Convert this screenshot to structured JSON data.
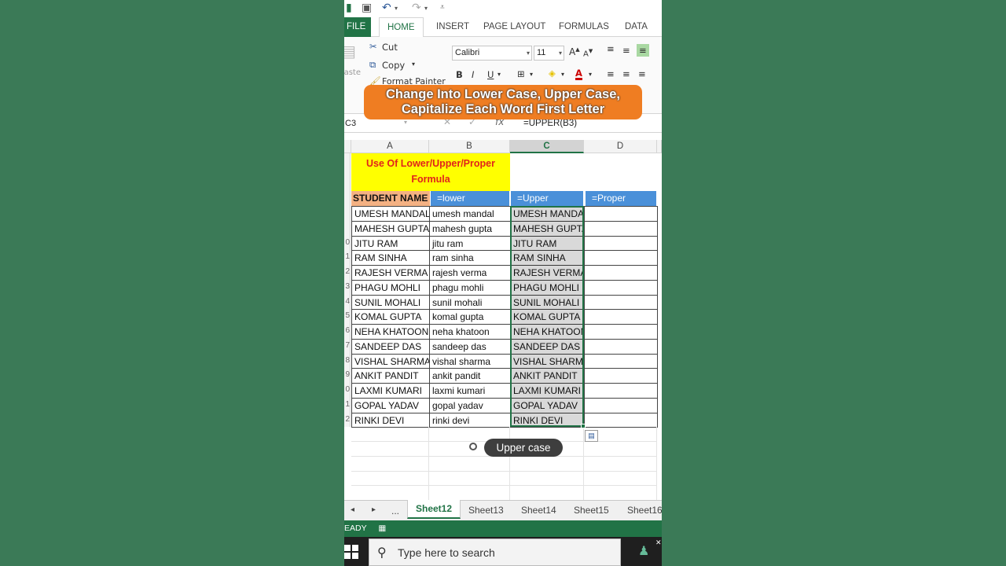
{
  "qat": {
    "undo_icon": "undo-icon",
    "redo_icon": "redo-icon",
    "save_icon": "save-icon"
  },
  "tabs": {
    "file": "FILE",
    "home": "HOME",
    "insert": "INSERT",
    "page_layout": "PAGE LAYOUT",
    "formulas": "FORMULAS",
    "data": "DATA"
  },
  "ribbon": {
    "cut": "Cut",
    "copy": "Copy",
    "format_painter": "Format Painter",
    "paste": "Paste",
    "font_name": "Calibri",
    "font_size": "11",
    "bold": "B",
    "italic": "I",
    "underline": "U"
  },
  "banner": {
    "line1": "Change Into Lower Case, Upper Case,",
    "line2": "Capitalize Each Word First Letter"
  },
  "formula_bar": {
    "name_box": "C3",
    "cancel": "✕",
    "enter": "✓",
    "fx": "fx",
    "formula": "=UPPER(B3)"
  },
  "columns": [
    "A",
    "B",
    "C",
    "D"
  ],
  "title": {
    "line1": "Use Of Lower/Upper/Proper",
    "line2": "Formula"
  },
  "headers": {
    "name": "STUDENT NAME",
    "lower": "=lower",
    "upper": "=Upper",
    "proper": "=Proper"
  },
  "rows": [
    {
      "name": "UMESH MANDAL",
      "lower": "umesh mandal",
      "upper": "UMESH MANDAL"
    },
    {
      "name": "MAHESH GUPTA",
      "lower": "mahesh gupta",
      "upper": "MAHESH GUPTA"
    },
    {
      "name": "JITU RAM",
      "lower": "jitu ram",
      "upper": "JITU RAM"
    },
    {
      "name": "RAM SINHA",
      "lower": "ram sinha",
      "upper": "RAM SINHA"
    },
    {
      "name": "RAJESH VERMA",
      "lower": "rajesh verma",
      "upper": "RAJESH VERMA"
    },
    {
      "name": "PHAGU MOHLI",
      "lower": "phagu mohli",
      "upper": "PHAGU MOHLI"
    },
    {
      "name": "SUNIL MOHALI",
      "lower": "sunil mohali",
      "upper": "SUNIL MOHALI"
    },
    {
      "name": "KOMAL GUPTA",
      "lower": "komal gupta",
      "upper": "KOMAL GUPTA"
    },
    {
      "name": "NEHA KHATOON",
      "lower": "neha khatoon",
      "upper": "NEHA KHATOON"
    },
    {
      "name": "SANDEEP DAS",
      "lower": "sandeep das",
      "upper": "SANDEEP DAS"
    },
    {
      "name": "VISHAL SHARMA",
      "lower": "vishal sharma",
      "upper": "VISHAL SHARMA"
    },
    {
      "name": "ANKIT PANDIT",
      "lower": "ankit pandit",
      "upper": "ANKIT PANDIT"
    },
    {
      "name": "LAXMI KUMARI",
      "lower": "laxmi kumari",
      "upper": "LAXMI KUMARI"
    },
    {
      "name": "GOPAL YADAV",
      "lower": "gopal yadav",
      "upper": "GOPAL YADAV"
    },
    {
      "name": "RINKI DEVI",
      "lower": "rinki devi",
      "upper": "RINKI DEVI"
    }
  ],
  "row_numbers": [
    "",
    "",
    "",
    "",
    "",
    "",
    "",
    "",
    "0",
    "1",
    "2",
    "3",
    "4",
    "5",
    "6",
    "7",
    "8",
    "9",
    "0",
    "1",
    "2"
  ],
  "caption": "Upper case",
  "sheet_tabs": {
    "nav_prev": "◂",
    "nav_next": "▸",
    "more": "...",
    "tabs": [
      "Sheet12",
      "Sheet13",
      "Sheet14",
      "Sheet15",
      "Sheet16"
    ]
  },
  "status": "EADY",
  "taskbar": {
    "search_placeholder": "Type here to search"
  },
  "colors": {
    "excel_green": "#217346",
    "title_yellow": "#ffff00",
    "title_red": "#e0241b",
    "header_orange": "#f4b183",
    "header_blue": "#4a90d9",
    "banner_orange": "#ef7d22"
  }
}
